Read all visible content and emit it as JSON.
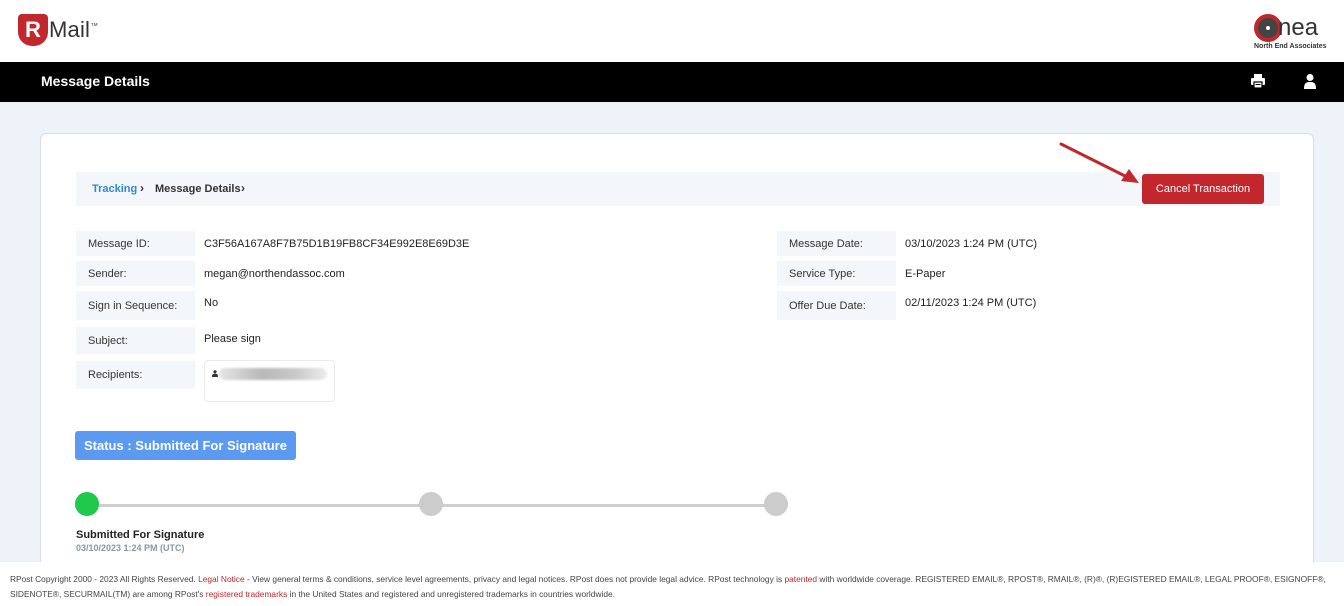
{
  "brand": {
    "app_logo_letter": "R",
    "app_logo_text": "Mail",
    "app_logo_tm": "™",
    "partner_logo_text": "nea",
    "partner_logo_sub": "North End Associates"
  },
  "header": {
    "title": "Message Details",
    "print_icon": "print-icon",
    "user_icon": "user-icon"
  },
  "breadcrumb": {
    "link": "Tracking",
    "separator": "›",
    "current": "Message Details"
  },
  "actions": {
    "cancel_label": "Cancel Transaction"
  },
  "details_left": [
    {
      "label": "Message ID:",
      "value": "C3F56A167A8F7B75D1B19FB8CF34E992E8E69D3E"
    },
    {
      "label": "Sender:",
      "value": "megan@northendassoc.com"
    },
    {
      "label": "Sign in Sequence:",
      "value": "No"
    },
    {
      "label": "Subject:",
      "value": "Please sign"
    },
    {
      "label": "Recipients:",
      "value": ""
    }
  ],
  "details_right": [
    {
      "label": "Message Date:",
      "value": "03/10/2023 1:24 PM (UTC)"
    },
    {
      "label": "Service Type:",
      "value": "E-Paper"
    },
    {
      "label": "Offer Due Date:",
      "value": "02/11/2023 1:24 PM (UTC)"
    }
  ],
  "status": {
    "badge": "Status : Submitted For Signature",
    "steps_total": 3,
    "steps_completed": 1,
    "step_label": "Submitted For Signature",
    "step_date": "03/10/2023 1:24 PM (UTC)"
  },
  "colors": {
    "brand_red": "#c1272d",
    "status_blue": "#5b9af0",
    "step_done": "#1ec94b",
    "step_pending": "#cccccc",
    "link_blue": "#2a8bd3"
  },
  "footer": {
    "p1": "RPost Copyright 2000 - 2023 All Rights Reserved. ",
    "legal_link": "Legal Notice",
    "p2": " - View general terms & conditions, service level agreements, privacy and legal notices. RPost does not provide legal advice. RPost technology is ",
    "patented_link": "patented",
    "p3": " with worldwide coverage. REGISTERED EMAIL®, RPOST®, RMAIL®, (R)®, (R)EGISTERED EMAIL®, LEGAL PROOF®, ESIGNOFF®, SIDENOTE®, SECURMAIL(TM) are among RPost's ",
    "trademarks_link": "registered trademarks",
    "p4": " in the United States and registered and unregistered trademarks in countries worldwide."
  }
}
